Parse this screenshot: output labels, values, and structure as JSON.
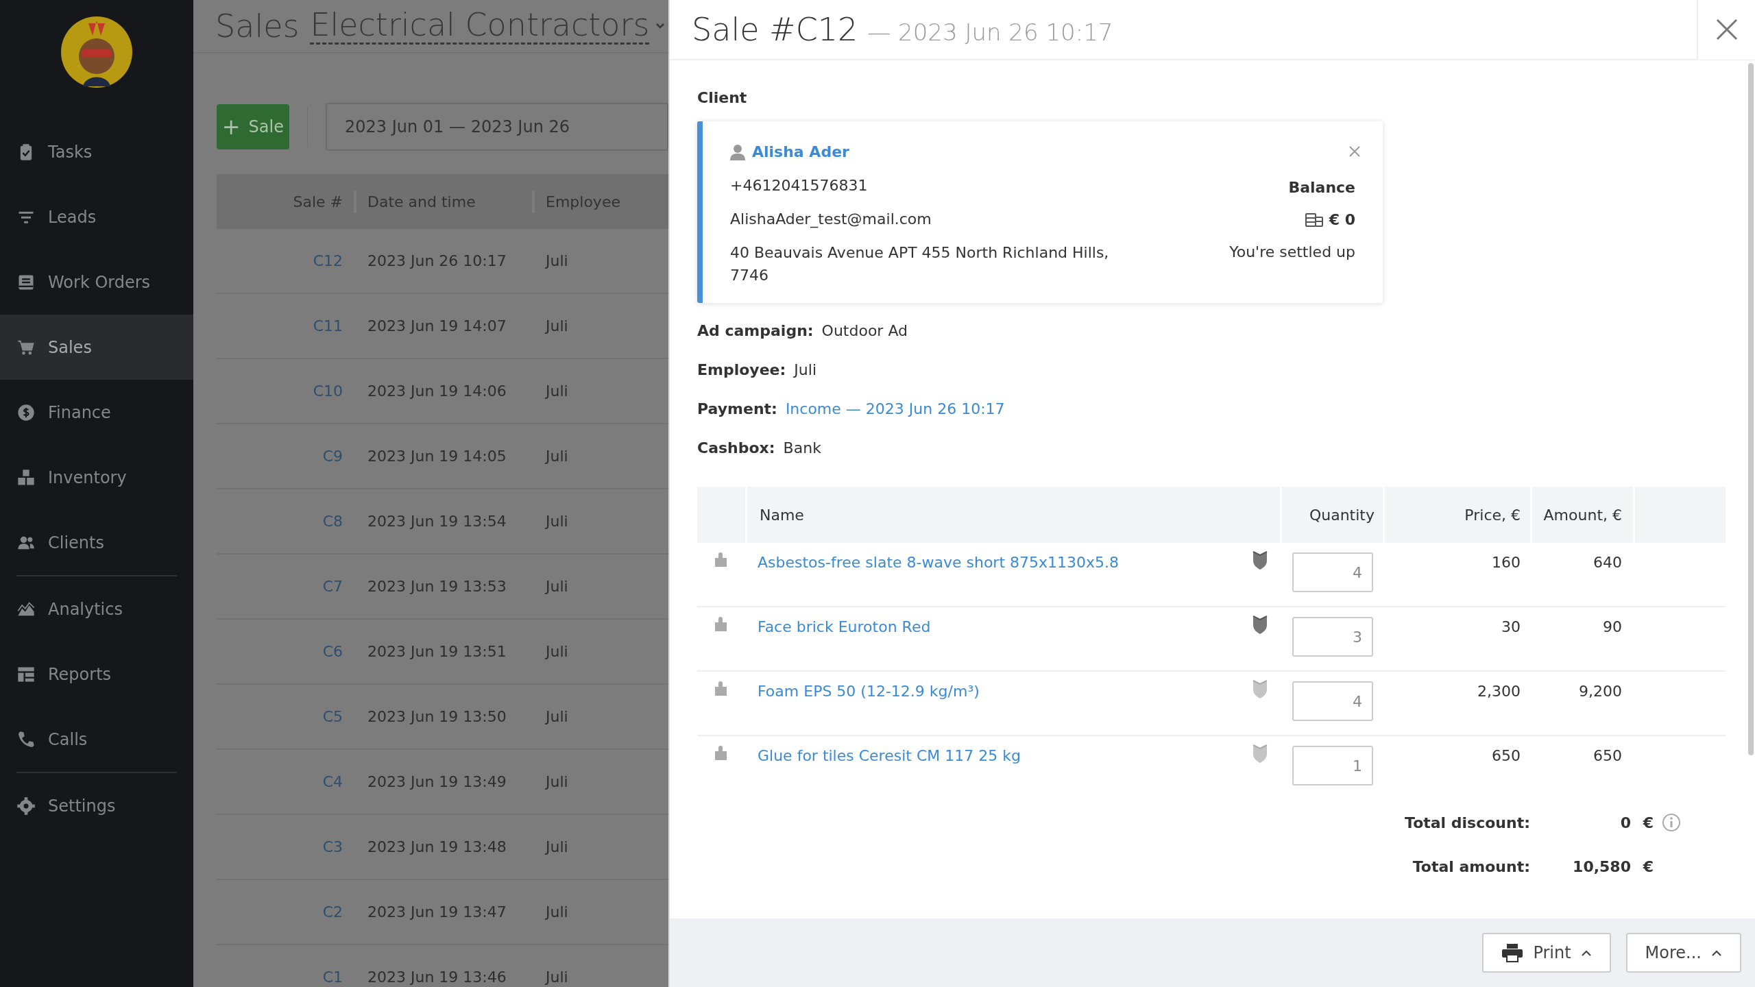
{
  "sidebar": {
    "groups": [
      [
        {
          "label": "Tasks",
          "selected": false
        },
        {
          "label": "Leads",
          "selected": false
        },
        {
          "label": "Work Orders",
          "selected": false
        },
        {
          "label": "Sales",
          "selected": true
        },
        {
          "label": "Finance",
          "selected": false
        },
        {
          "label": "Inventory",
          "selected": false
        },
        {
          "label": "Clients",
          "selected": false
        }
      ],
      [
        {
          "label": "Analytics",
          "selected": false
        },
        {
          "label": "Reports",
          "selected": false
        },
        {
          "label": "Calls",
          "selected": false
        }
      ],
      [
        {
          "label": "Settings",
          "selected": false
        }
      ]
    ]
  },
  "page": {
    "title": "Sales",
    "subtitle": "Electrical Contractors",
    "add_button": {
      "icon": "+",
      "label": "Sale"
    },
    "date_range": "2023 Jun 01 — 2023 Jun 26",
    "table": {
      "columns": [
        "Sale #",
        "Date and time",
        "Employee"
      ],
      "rows": [
        {
          "sale": "C12",
          "date": "2023 Jun 26 10:17",
          "employee": "Juli"
        },
        {
          "sale": "C11",
          "date": "2023 Jun 19 14:07",
          "employee": "Juli"
        },
        {
          "sale": "C10",
          "date": "2023 Jun 19 14:06",
          "employee": "Juli"
        },
        {
          "sale": "C9",
          "date": "2023 Jun 19 14:05",
          "employee": "Juli"
        },
        {
          "sale": "C8",
          "date": "2023 Jun 19 13:54",
          "employee": "Juli"
        },
        {
          "sale": "C7",
          "date": "2023 Jun 19 13:53",
          "employee": "Juli"
        },
        {
          "sale": "C6",
          "date": "2023 Jun 19 13:51",
          "employee": "Juli"
        },
        {
          "sale": "C5",
          "date": "2023 Jun 19 13:50",
          "employee": "Juli"
        },
        {
          "sale": "C4",
          "date": "2023 Jun 19 13:49",
          "employee": "Juli"
        },
        {
          "sale": "C3",
          "date": "2023 Jun 19 13:48",
          "employee": "Juli"
        },
        {
          "sale": "C2",
          "date": "2023 Jun 19 13:47",
          "employee": "Juli"
        },
        {
          "sale": "C1",
          "date": "2023 Jun 19 13:46",
          "employee": "Juli"
        }
      ]
    }
  },
  "panel": {
    "title": "Sale #C12",
    "subtitle": "— 2023 Jun 26 10:17",
    "client_label": "Client",
    "client": {
      "name": "Alisha Ader",
      "phone": "+4612041576831",
      "email": "AlishaAder_test@mail.com",
      "address": "40 Beauvais Avenue APT 455 North Richland Hills, 7746",
      "balance_label": "Balance",
      "balance": "€ 0",
      "balance_note": "You're settled up"
    },
    "fields": [
      {
        "label": "Ad campaign:",
        "value": "Outdoor Ad",
        "kind": "text"
      },
      {
        "label": "Employee:",
        "value": "Juli",
        "kind": "text"
      },
      {
        "label": "Payment:",
        "value": "Income — 2023 Jun 26 10:17",
        "kind": "link"
      },
      {
        "label": "Cashbox:",
        "value": "Bank",
        "kind": "text"
      }
    ],
    "products": {
      "columns": [
        "Name",
        "Quantity",
        "Price, €",
        "Amount, €"
      ],
      "rows": [
        {
          "name": "Asbestos-free slate 8-wave short 875x1130x5.8",
          "highlighted": true,
          "quantity": "4",
          "price": "160",
          "amount": "640"
        },
        {
          "name": "Face brick Euroton Red",
          "highlighted": true,
          "quantity": "3",
          "price": "30",
          "amount": "90"
        },
        {
          "name": "Foam EPS 50 (12-12.9 kg/m³)",
          "highlighted": false,
          "quantity": "4",
          "price": "2,300",
          "amount": "9,200"
        },
        {
          "name": "Glue for tiles Ceresit CM 117 25 kg",
          "highlighted": false,
          "quantity": "1",
          "price": "650",
          "amount": "650"
        }
      ]
    },
    "totals": [
      {
        "label": "Total discount:",
        "value": "0",
        "currency": "€",
        "info": true
      },
      {
        "label": "Total amount:",
        "value": "10,580",
        "currency": "€",
        "info": false
      }
    ],
    "footer_buttons": [
      {
        "label": "Print",
        "kind": "print"
      },
      {
        "label": "More...",
        "kind": "more"
      }
    ]
  }
}
